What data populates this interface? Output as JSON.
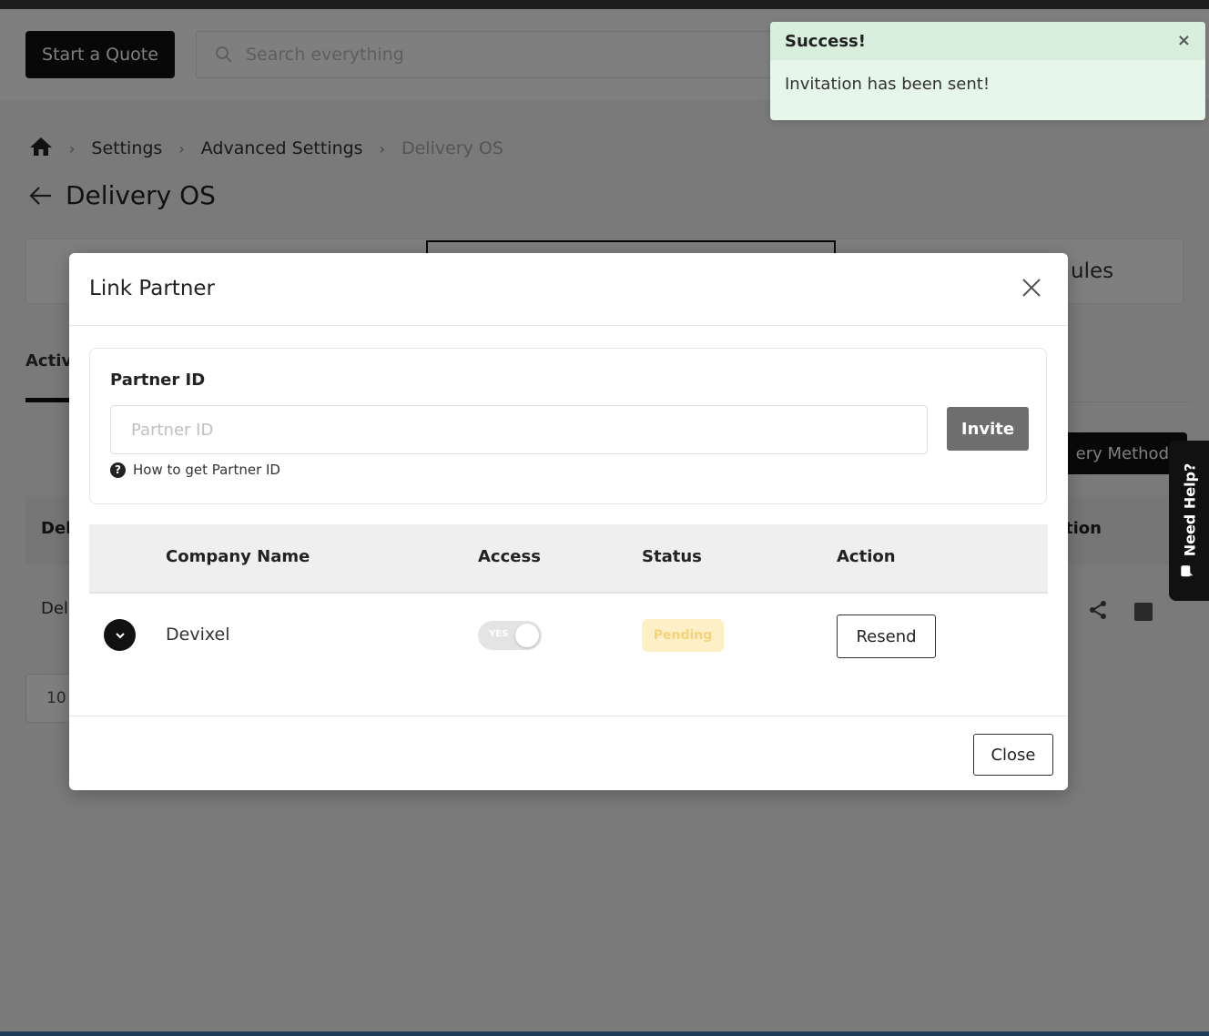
{
  "header": {
    "start_quote_label": "Start a Quote",
    "search_placeholder": "Search everything"
  },
  "breadcrumb": {
    "items": [
      "Settings",
      "Advanced Settings",
      "Delivery OS"
    ]
  },
  "page": {
    "title": "Delivery OS",
    "tab_right_partial": "ules",
    "subtab_partial": "Activ",
    "method_button_partial": "ery Method",
    "table_header_left_partial": "Del",
    "table_header_right_partial": "tion",
    "table_row_left_partial": "Del",
    "pager_value": "10"
  },
  "toast": {
    "title": "Success!",
    "close_glyph": "×",
    "message": "Invitation has been sent!"
  },
  "modal": {
    "title": "Link Partner",
    "partner_id_label": "Partner ID",
    "partner_id_placeholder": "Partner ID",
    "partner_id_value": "",
    "invite_label": "Invite",
    "help_text": "How to get Partner ID",
    "table": {
      "columns": [
        "Company Name",
        "Access",
        "Status",
        "Action"
      ],
      "rows": [
        {
          "company": "Devixel",
          "access_label": "YES",
          "access_enabled": true,
          "status": "Pending",
          "action_label": "Resend"
        }
      ]
    },
    "close_label": "Close"
  },
  "need_help": {
    "label": "Need Help?"
  },
  "colors": {
    "primary": "#111111",
    "toast_bg": "#e6f6ea",
    "pending_bg": "#fdf0c7",
    "pending_text": "#f4d37a",
    "invite_bg": "#6e6e6e"
  },
  "icons": [
    "home-icon",
    "chevron-right-icon",
    "arrow-left-icon",
    "search-icon",
    "close-icon",
    "question-icon",
    "chevron-down-icon",
    "share-icon",
    "chat-icon"
  ]
}
